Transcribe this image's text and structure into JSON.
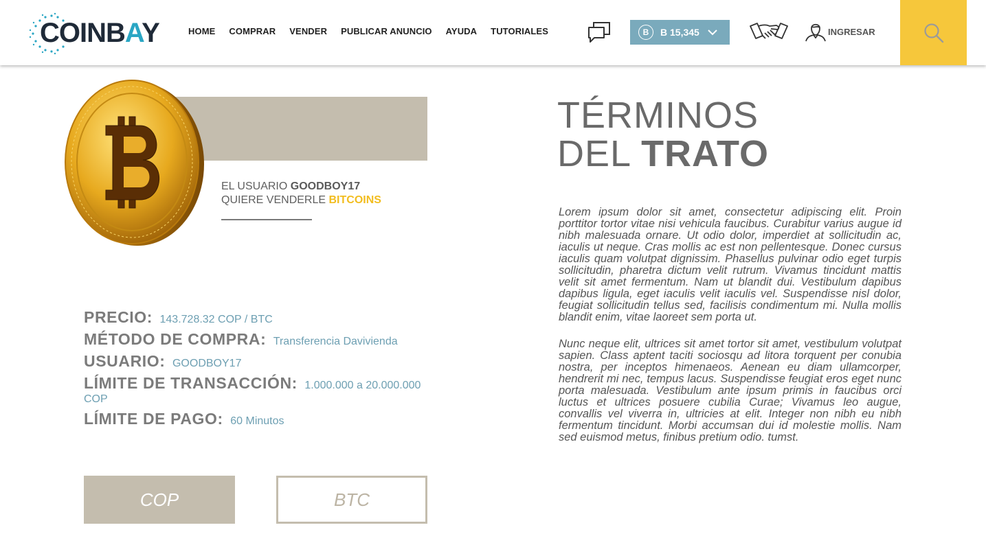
{
  "header": {
    "logo_prefix": "C",
    "logo_main": "OINB",
    "logo_accent": "A",
    "logo_suffix": "Y",
    "nav": [
      "HOME",
      "COMPRAR",
      "VENDER",
      "PUBLICAR ANUNCIO",
      "AYUDA",
      "TUTORIALES"
    ],
    "balance": "B 15,345",
    "balance_coin_symbol": "B",
    "login_label": "INGRESAR",
    "colors": {
      "balance_bg": "#7aaabc",
      "search_bg": "#f6c73b"
    },
    "icons": [
      "chat-icon",
      "bitcoin-coin-icon",
      "chevron-down-icon",
      "handshake-icon",
      "user-icon",
      "search-icon"
    ]
  },
  "offer": {
    "line1_prefix": "EL USUARIO",
    "username": "GOODBOY17",
    "line2_prefix": "QUIERE VENDERLE",
    "asset": "BITCOINS",
    "details": [
      {
        "label": "PRECIO:",
        "value": "143.728.32 COP / BTC"
      },
      {
        "label": "MÉTODO DE COMPRA:",
        "value": "Transferencia Davivienda"
      },
      {
        "label": "USUARIO:",
        "value": "GOODBOY17"
      },
      {
        "label": "LÍMITE DE TRANSACCIÓN:",
        "value": "1.000.000 a 20.000.000 COP"
      },
      {
        "label": "LÍMITE DE PAGO:",
        "value": "60 Minutos"
      }
    ],
    "currency_cop": "COP",
    "currency_btc": "BTC",
    "colors": {
      "accent_beige": "#c4bdae",
      "value_blue": "#6d9fb2",
      "highlight_yellow": "#f2bd1f"
    }
  },
  "terms": {
    "title_line1": "TÉRMINOS",
    "title_line2_light": "DEL",
    "title_line2_bold": "TRATO",
    "paragraphs": [
      "Lorem ipsum dolor sit amet, consectetur adipiscing elit. Proin porttitor tortor vitae nisi vehicula faucibus. Curabitur varius augue id nibh malesuada ornare. Ut odio dolor, imperdiet at sollicitudin ac, iaculis ut neque. Cras mollis ac est non pellentesque. Donec cursus iaculis quam volutpat dignissim. Phasellus pulvinar odio eget turpis sollicitudin, pharetra dictum velit rutrum. Vivamus tincidunt mattis velit sit amet fermentum. Nam ut blandit dui. Vestibulum dapibus dapibus ligula, eget iaculis velit iaculis vel. Suspendisse nisl dolor, feugiat sollicitudin tellus sed, facilisis condimentum mi. Nulla mollis blandit enim, vitae laoreet sem porta ut.",
      "Nunc neque elit, ultrices sit amet tortor sit amet, vestibulum volutpat sapien. Class aptent taciti sociosqu ad litora torquent per conubia nostra, per inceptos himenaeos. Aenean eu diam ullamcorper, hendrerit mi nec, tempus lacus. Suspendisse feugiat eros eget nunc porta malesuada. Vestibulum ante ipsum primis in faucibus orci luctus et ultrices posuere cubilia Curae; Vivamus leo augue, convallis vel viverra in, ultricies at elit. Integer non nibh eu nibh fermentum tincidunt. Morbi accumsan dui id molestie mollis. Nam sed euismod metus, finibus pretium odio. tumst."
    ]
  }
}
